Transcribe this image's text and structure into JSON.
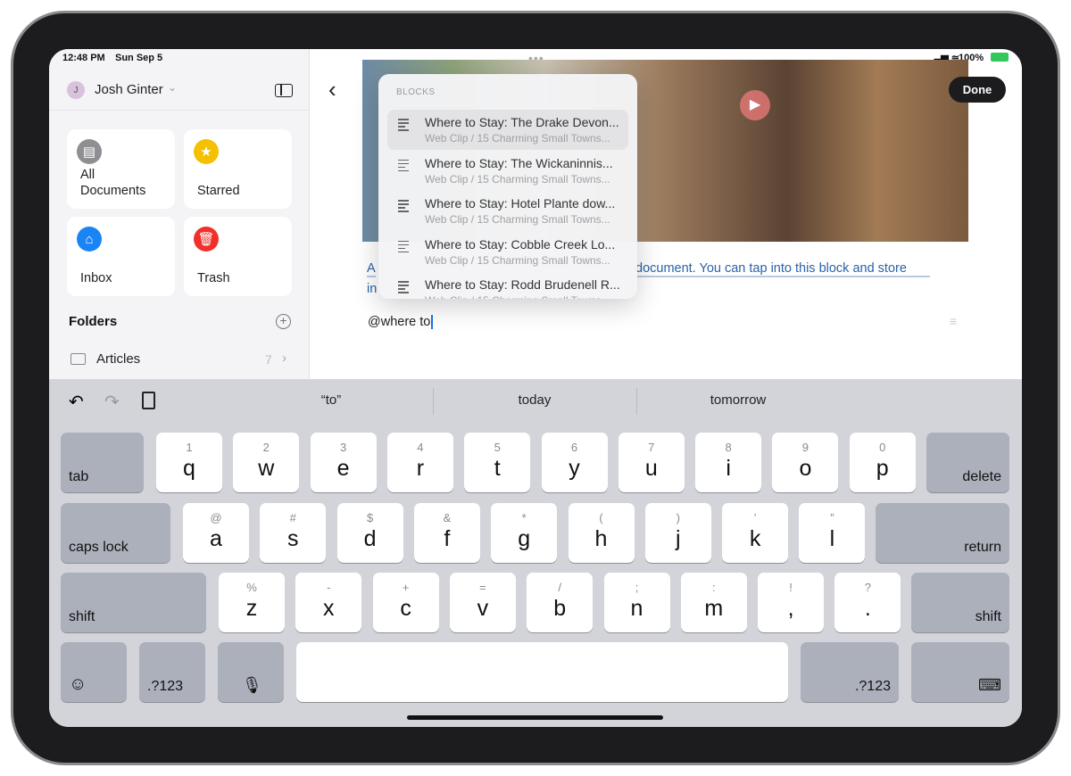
{
  "status": {
    "time": "12:48 PM",
    "date": "Sun Sep 5",
    "battery": "100%"
  },
  "sidebar": {
    "user": "Josh Ginter",
    "user_initial": "J",
    "cards": [
      {
        "label": "All Documents",
        "icon": "document-icon",
        "color": "#8e8e93"
      },
      {
        "label": "Starred",
        "icon": "star-icon",
        "color": "#f5c000"
      },
      {
        "label": "Inbox",
        "icon": "inbox-icon",
        "color": "#1a84f5"
      },
      {
        "label": "Trash",
        "icon": "trash-icon",
        "color": "#f0302a"
      }
    ],
    "folders_title": "Folders",
    "folders": [
      {
        "name": "Articles",
        "count": "7"
      }
    ]
  },
  "editor": {
    "done": "Done",
    "link_a": "A",
    "link_b": "document. You can tap into this block and store",
    "link_c": "in",
    "input": "@where to"
  },
  "popup": {
    "header": "BLOCKS",
    "items": [
      {
        "title": "Where to Stay: The Drake Devon...",
        "sub": "Web Clip / 15 Charming Small Towns..."
      },
      {
        "title": "Where to Stay: The Wickaninnis...",
        "sub": "Web Clip / 15 Charming Small Towns..."
      },
      {
        "title": "Where to Stay: Hotel Plante dow...",
        "sub": "Web Clip / 15 Charming Small Towns..."
      },
      {
        "title": "Where to Stay: Cobble Creek Lo...",
        "sub": "Web Clip / 15 Charming Small Towns..."
      },
      {
        "title": "Where to Stay: Rodd Brudenell R...",
        "sub": "Web Clip / 15 Charming Small Towns..."
      }
    ]
  },
  "keyboard": {
    "suggestions": [
      "“to”",
      "today",
      "tomorrow"
    ],
    "row1": [
      [
        "1",
        "q"
      ],
      [
        "2",
        "w"
      ],
      [
        "3",
        "e"
      ],
      [
        "4",
        "r"
      ],
      [
        "5",
        "t"
      ],
      [
        "6",
        "y"
      ],
      [
        "7",
        "u"
      ],
      [
        "8",
        "i"
      ],
      [
        "9",
        "o"
      ],
      [
        "0",
        "p"
      ]
    ],
    "row2": [
      [
        "@",
        "a"
      ],
      [
        "#",
        "s"
      ],
      [
        "$",
        "d"
      ],
      [
        "&",
        "f"
      ],
      [
        "*",
        "g"
      ],
      [
        "(",
        "h"
      ],
      [
        ")",
        "j"
      ],
      [
        "’",
        "k"
      ],
      [
        "”",
        "l"
      ]
    ],
    "row3": [
      [
        "%",
        "z"
      ],
      [
        "-",
        "x"
      ],
      [
        "+",
        "c"
      ],
      [
        "=",
        "v"
      ],
      [
        "/",
        "b"
      ],
      [
        ";",
        "n"
      ],
      [
        ":",
        "m"
      ],
      [
        "!",
        ","
      ],
      [
        "?",
        "."
      ]
    ],
    "tab": "tab",
    "delete": "delete",
    "caps": "caps lock",
    "return": "return",
    "shift": "shift",
    "num": ".?123"
  }
}
